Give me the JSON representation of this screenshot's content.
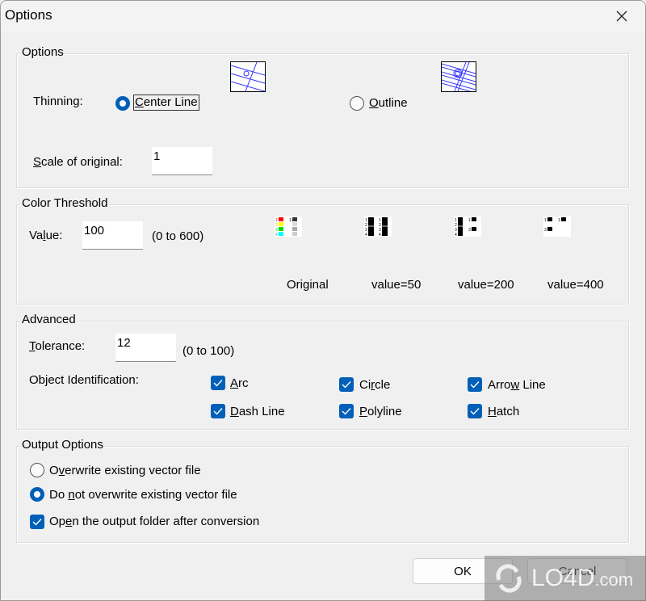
{
  "window": {
    "title": "Options",
    "close_icon": "close-icon"
  },
  "options_group": {
    "title": "Options",
    "thinning_label": "Thinning:",
    "thinning_options": [
      {
        "label": "Center Line",
        "selected": true,
        "thumbnail": "center-line-preview"
      },
      {
        "label": "Outline",
        "selected": false,
        "thumbnail": "outline-preview"
      }
    ],
    "scale_label": "Scale of original:",
    "scale_value": "1"
  },
  "color_threshold": {
    "title": "Color Threshold",
    "value_label": "Value:",
    "value": "100",
    "range_hint": "(0 to 600)",
    "samples": [
      {
        "caption": "Original"
      },
      {
        "caption": "value=50"
      },
      {
        "caption": "value=200"
      },
      {
        "caption": "value=400"
      }
    ],
    "sample_colors": {
      "red": "#ff0000",
      "yellow": "#ffff00",
      "green": "#00dd00",
      "cyan": "#00ffff"
    }
  },
  "advanced": {
    "title": "Advanced",
    "tolerance_label": "Tolerance:",
    "tolerance_value": "12",
    "tolerance_hint": "(0 to 100)",
    "object_id_label": "Object Identification:",
    "objects": [
      {
        "label": "Arc",
        "checked": true
      },
      {
        "label": "Circle",
        "checked": true
      },
      {
        "label": "Arrow Line",
        "checked": true
      },
      {
        "label": "Dash Line",
        "checked": true
      },
      {
        "label": "Polyline",
        "checked": true
      },
      {
        "label": "Hatch",
        "checked": true
      }
    ]
  },
  "output_options": {
    "title": "Output Options",
    "radios": [
      {
        "label": "Overwrite existing vector file",
        "selected": false
      },
      {
        "label": "Do not overwrite existing vector file",
        "selected": true
      }
    ],
    "open_folder": {
      "label": "Open the output folder after conversion",
      "checked": true
    }
  },
  "buttons": {
    "ok": "OK",
    "cancel": "Cancel"
  },
  "watermark": {
    "text": "LO4D",
    "suffix": ".com"
  },
  "colors": {
    "accent": "#005fb8",
    "background": "#f0f0f0"
  }
}
